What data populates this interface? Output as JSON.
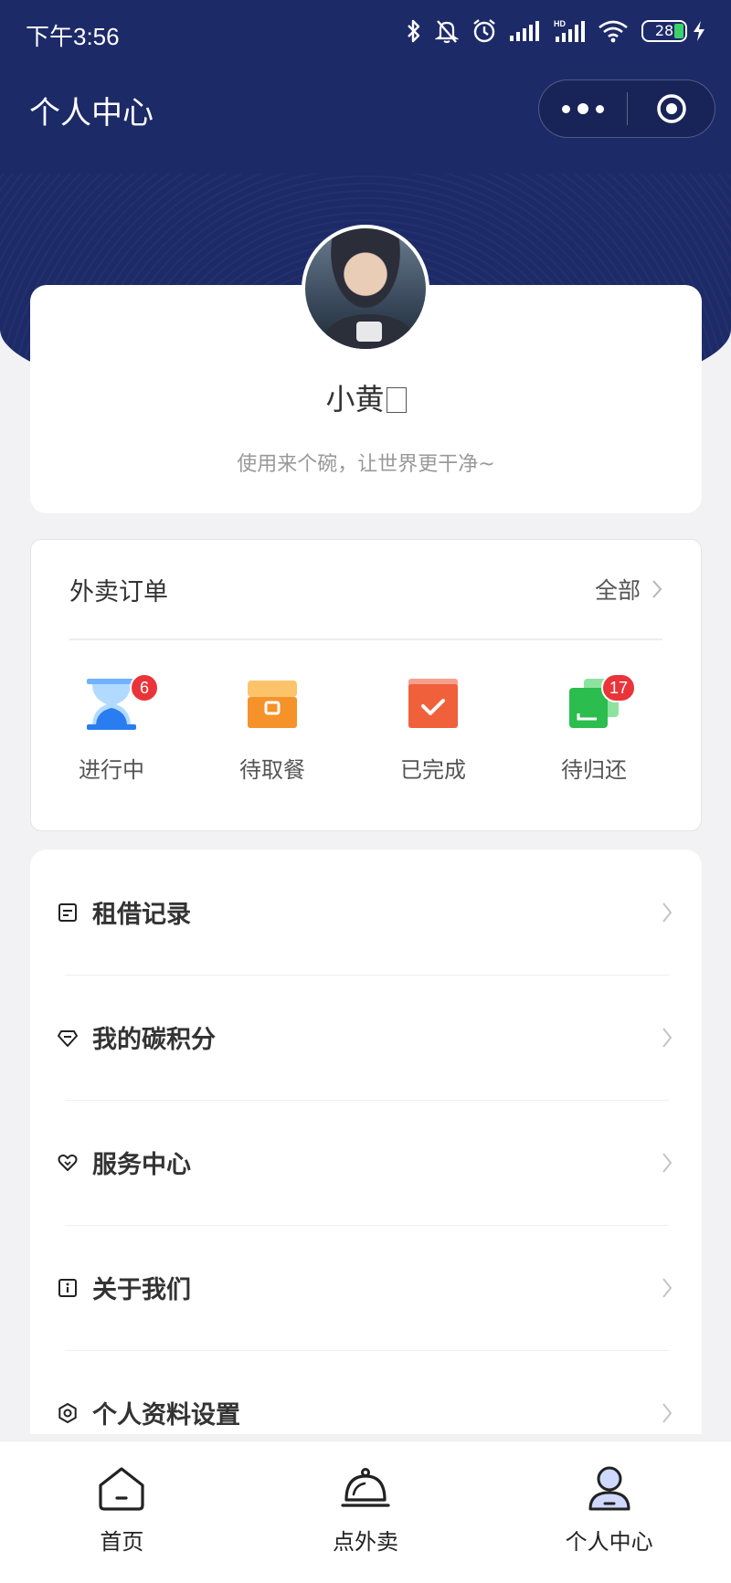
{
  "status_bar": {
    "time": "下午3:56",
    "battery": "28"
  },
  "nav": {
    "title": "个人中心"
  },
  "profile": {
    "name": "小黄",
    "motto": "使用来个碗，让世界更干净~"
  },
  "orders": {
    "title": "外卖订单",
    "all_label": "全部",
    "items": [
      {
        "label": "进行中",
        "badge": "6",
        "icon": "hourglass-icon",
        "color": "#2a7df0"
      },
      {
        "label": "待取餐",
        "badge": "",
        "icon": "box-icon",
        "color": "#f5922a"
      },
      {
        "label": "已完成",
        "badge": "",
        "icon": "check-bag-icon",
        "color": "#f0603a"
      },
      {
        "label": "待归还",
        "badge": "17",
        "icon": "return-icon",
        "color": "#2bbd4e"
      }
    ]
  },
  "menu": {
    "items": [
      {
        "label": "租借记录",
        "icon": "doc-list-icon"
      },
      {
        "label": "我的碳积分",
        "icon": "diamond-icon"
      },
      {
        "label": "服务中心",
        "icon": "heart-icon"
      },
      {
        "label": "关于我们",
        "icon": "info-icon"
      },
      {
        "label": "个人资料设置",
        "icon": "settings-icon"
      }
    ]
  },
  "tabbar": {
    "items": [
      {
        "label": "首页",
        "icon": "home-icon"
      },
      {
        "label": "点外卖",
        "icon": "food-cloche-icon"
      },
      {
        "label": "个人中心",
        "icon": "user-icon",
        "active": true
      }
    ]
  },
  "colors": {
    "header": "#1d2a68",
    "badge": "#e9343a"
  }
}
